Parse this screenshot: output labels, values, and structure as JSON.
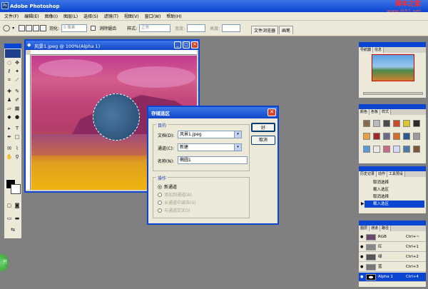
{
  "app": {
    "title": "Adobe Photoshop",
    "logo": "Ps"
  },
  "watermark": {
    "text": "脚本之家",
    "url": "www.Jb51.net"
  },
  "menu": [
    "文件(F)",
    "编辑(E)",
    "图像(I)",
    "图层(L)",
    "选择(S)",
    "滤镜(T)",
    "视图(V)",
    "窗口(W)",
    "帮助(H)"
  ],
  "options": {
    "feather_label": "羽化:",
    "feather_value": "0 像素",
    "antialias_label": "消除锯齿",
    "style_label": "样式:",
    "style_value": "正常",
    "width_label": "宽度:",
    "height_label": "高度:"
  },
  "palette_well": [
    "文件浏览器",
    "画笔"
  ],
  "document": {
    "title": "风景1.jpeg @ 100%(Alpha 1)"
  },
  "dialog": {
    "title": "存储选区",
    "dest_label": "目的",
    "doc_label": "文档(D):",
    "doc_value": "风景1.jpeg",
    "channel_label": "通道(C):",
    "channel_value": "新建",
    "name_label": "名称(N):",
    "name_value": "椭圆1",
    "op_label": "操作",
    "ops": [
      "新通道",
      "添加到通道(A)",
      "从通道中减去(S)",
      "与通道交叉(I)"
    ],
    "ok": "好",
    "cancel": "取消"
  },
  "navigator": {
    "tabs": [
      "导航器",
      "信息"
    ]
  },
  "color_panel": {
    "tabs": [
      "颜色",
      "色板",
      "样式"
    ]
  },
  "history": {
    "tabs": [
      "历史记录",
      "动作",
      "工具预设"
    ],
    "items": [
      "取消选择",
      "载入选区",
      "取消选择",
      "载入选区"
    ],
    "selected_index": 3
  },
  "channels": {
    "tabs": [
      "图层",
      "通道",
      "路径"
    ],
    "rows": [
      {
        "name": "RGB",
        "key": "Ctrl+~"
      },
      {
        "name": "红",
        "key": "Ctrl+1"
      },
      {
        "name": "绿",
        "key": "Ctrl+2"
      },
      {
        "name": "蓝",
        "key": "Ctrl+3"
      },
      {
        "name": "Alpha 1",
        "key": "Ctrl+4"
      }
    ],
    "selected_index": 4
  },
  "start_button": {
    "label": "开"
  }
}
